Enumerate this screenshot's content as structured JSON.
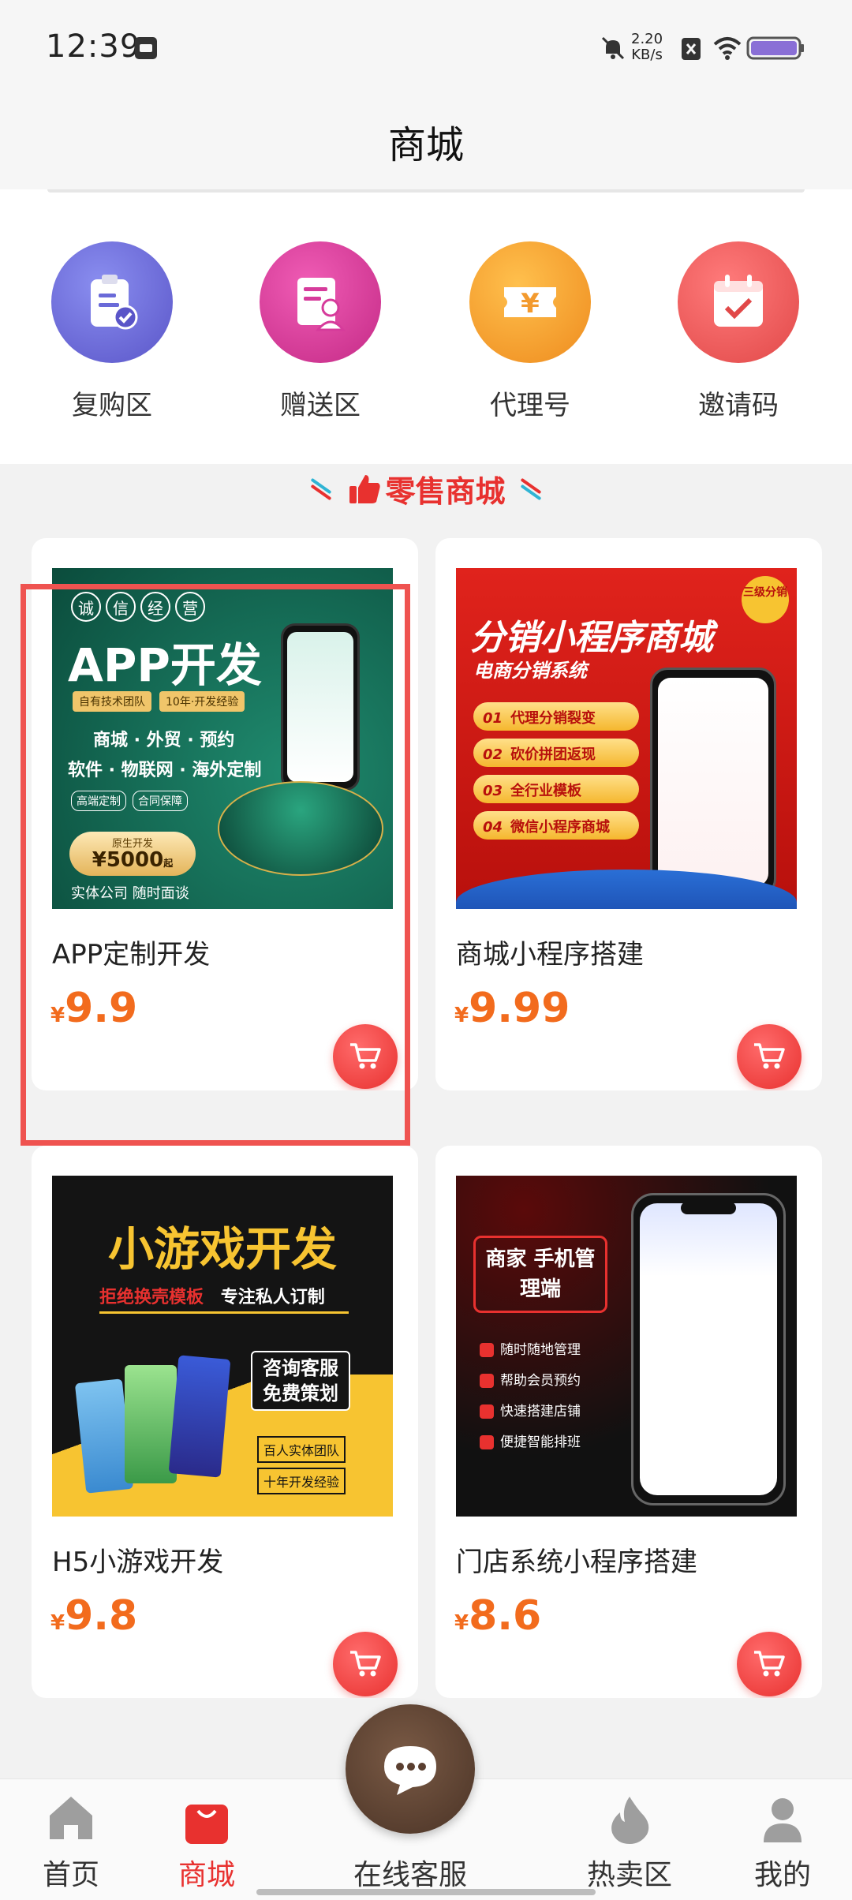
{
  "status_bar": {
    "time": "12:39",
    "speed_value": "2.20",
    "speed_unit": "KB/s"
  },
  "header": {
    "title": "商城"
  },
  "categories": [
    {
      "label": "复购区",
      "icon": "clipboard-check-icon",
      "color": "#6a6ad8"
    },
    {
      "label": "赠送区",
      "icon": "document-user-icon",
      "color": "#d63b9b"
    },
    {
      "label": "代理号",
      "icon": "yen-ticket-icon",
      "color": "#f39a2e"
    },
    {
      "label": "邀请码",
      "icon": "calendar-check-icon",
      "color": "#ec5d5d"
    }
  ],
  "section": {
    "title": "零售商城",
    "accent": "#e8312f"
  },
  "products": [
    {
      "name": "APP定制开发",
      "currency": "¥",
      "price": "9.9",
      "image": {
        "badges": [
          "诚",
          "信",
          "经",
          "营"
        ],
        "headline": "APP开发",
        "tags": [
          "自有技术团队",
          "10年·开发经验"
        ],
        "line1": "商城 · 外贸 · 预约",
        "line2": "软件 · 物联网 · 海外定制",
        "chips": [
          "高端定制",
          "合同保障"
        ],
        "promo_label": "原生开发",
        "promo_value": "¥5000",
        "promo_suffix": "起",
        "footer": "实体公司  随时面谈"
      }
    },
    {
      "name": "商城小程序搭建",
      "currency": "¥",
      "price": "9.99",
      "image": {
        "headline": "分销小程序商城",
        "subline": "电商分销系统",
        "corner": "三级分销",
        "items": [
          {
            "no": "01",
            "text": "代理分销裂变"
          },
          {
            "no": "02",
            "text": "砍价拼团返现"
          },
          {
            "no": "03",
            "text": "全行业模板"
          },
          {
            "no": "04",
            "text": "微信小程序商城"
          }
        ]
      }
    },
    {
      "name": "H5小游戏开发",
      "currency": "¥",
      "price": "9.8",
      "image": {
        "headline": "小游戏开发",
        "tag1": "拒绝换壳模板",
        "tag2": "专注私人订制",
        "box": "咨询客服 免费策划",
        "chip1": "百人实体团队",
        "chip2": "十年开发经验"
      }
    },
    {
      "name": "门店系统小程序搭建",
      "currency": "¥",
      "price": "8.6",
      "image": {
        "box": "商家 手机管理端",
        "features": [
          "随时随地管理",
          "帮助会员预约",
          "快速搭建店铺",
          "便捷智能排班"
        ]
      }
    }
  ],
  "bottom_nav": [
    {
      "label": "首页",
      "icon": "home-icon",
      "active": false
    },
    {
      "label": "商城",
      "icon": "shopping-bag-icon",
      "active": true
    },
    {
      "label": "在线客服",
      "icon": "chat-bubble-icon",
      "active": false
    },
    {
      "label": "热卖区",
      "icon": "flame-icon",
      "active": false
    },
    {
      "label": "我的",
      "icon": "user-icon",
      "active": false
    }
  ],
  "colors": {
    "price": "#f26b1d",
    "active_tab": "#e8312f",
    "selection": "#ef5350"
  }
}
